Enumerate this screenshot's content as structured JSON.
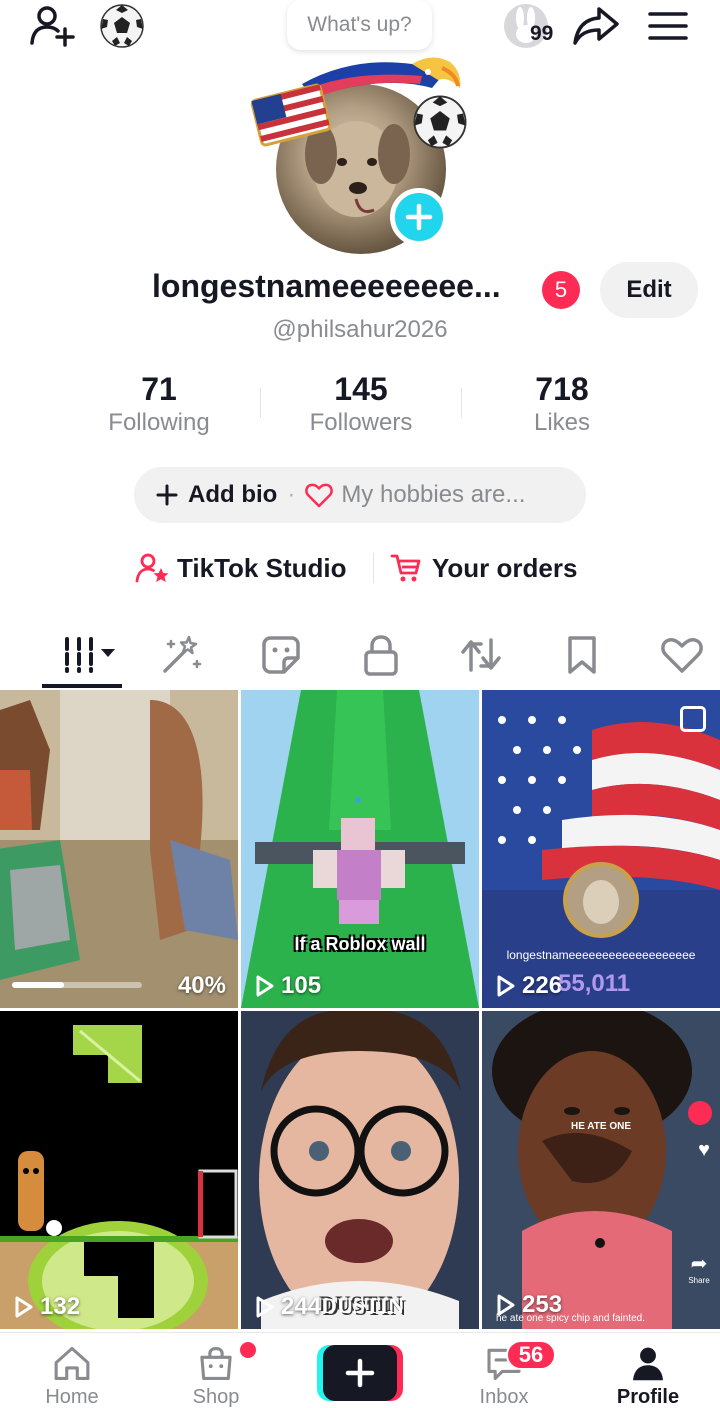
{
  "topbar": {
    "whats_up": "What's up?",
    "badge_count": "99"
  },
  "profile": {
    "username": "longestnameeeeeeee...",
    "notification_count": "5",
    "edit_label": "Edit",
    "handle": "@philsahur2026"
  },
  "stats": [
    {
      "value": "71",
      "label": "Following"
    },
    {
      "value": "145",
      "label": "Followers"
    },
    {
      "value": "718",
      "label": "Likes"
    }
  ],
  "bio": {
    "add_label": "Add bio",
    "separator": "·",
    "hint": "My hobbies are..."
  },
  "links": {
    "studio": "TikTok Studio",
    "orders": "Your orders"
  },
  "tabs": [
    "videos",
    "ai-effects",
    "stickers",
    "private",
    "reposts",
    "favorites",
    "liked"
  ],
  "grid": [
    {
      "views": "40%",
      "progress": 0.4,
      "caption": ""
    },
    {
      "views": "105",
      "caption": "If a Roblox wall"
    },
    {
      "views": "226",
      "caption": "longestnameeeeeeeeeeeeeeeeeee",
      "overlay": "55,011"
    },
    {
      "views": "132",
      "caption": ""
    },
    {
      "views": "244",
      "caption": "DUSTIN"
    },
    {
      "views": "253",
      "caption": "HE ATE ONE",
      "subcaption": "he ate one spicy chip and fainted.",
      "share_label": "Share"
    }
  ],
  "nav": {
    "home": "Home",
    "shop": "Shop",
    "inbox": "Inbox",
    "inbox_count": "56",
    "profile": "Profile"
  },
  "colors": {
    "accent_red": "#fe2c55",
    "accent_cyan": "#20d5ec",
    "text_primary": "#161823",
    "text_secondary": "#8a8b91"
  }
}
